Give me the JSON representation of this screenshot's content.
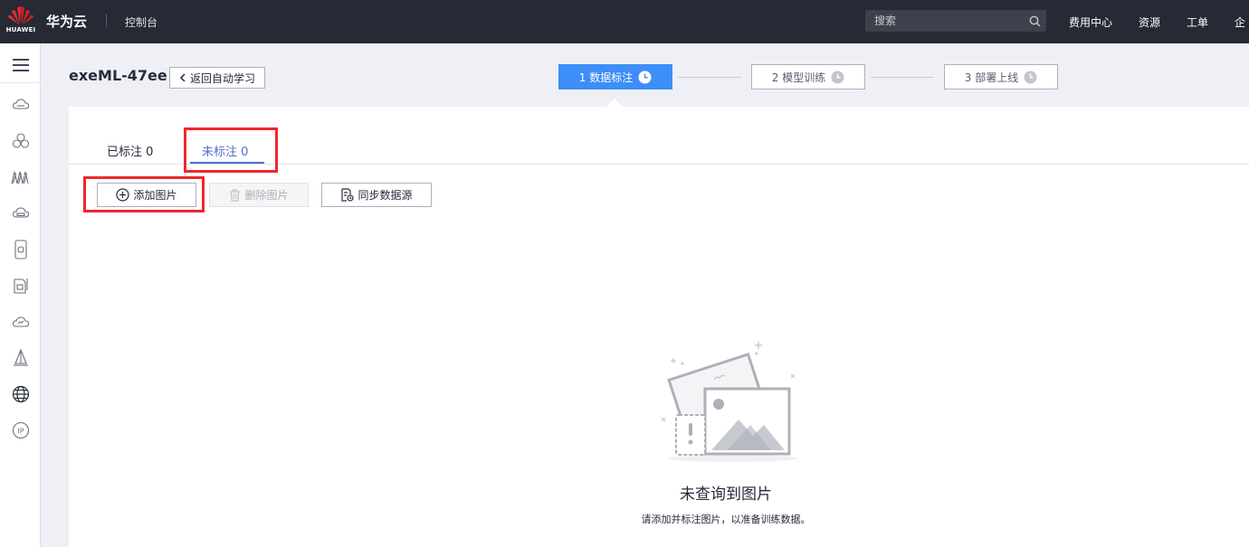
{
  "topbar": {
    "logo_text": "HUAWEI",
    "brand": "华为云",
    "console": "控制台",
    "search_placeholder": "搜索",
    "nav": [
      "费用中心",
      "资源",
      "工单",
      "企"
    ]
  },
  "sidebar": {
    "icons": [
      "menu-icon",
      "cloud-server-icon",
      "cluster-icon",
      "network-icon",
      "storage-icon",
      "device-icon",
      "file-icon",
      "cloud-check-icon",
      "tower-icon",
      "globe-icon",
      "ip-icon"
    ]
  },
  "header": {
    "job_title": "exeML-47ee",
    "back_label": "返回自动学习",
    "steps": [
      "1 数据标注",
      "2 模型训练",
      "3 部署上线"
    ]
  },
  "tabs": {
    "labeled": "已标注 0",
    "unlabeled": "未标注 0"
  },
  "toolbar": {
    "add_label": "添加图片",
    "delete_label": "删除图片",
    "sync_label": "同步数据源"
  },
  "empty": {
    "title": "未查询到图片",
    "subtitle": "请添加并标注图片，以准备训练数据。"
  },
  "colors": {
    "topbar": "#252a35",
    "accent": "#3d8ef6",
    "tab_active": "#526ecc",
    "highlight": "#f0262d"
  }
}
